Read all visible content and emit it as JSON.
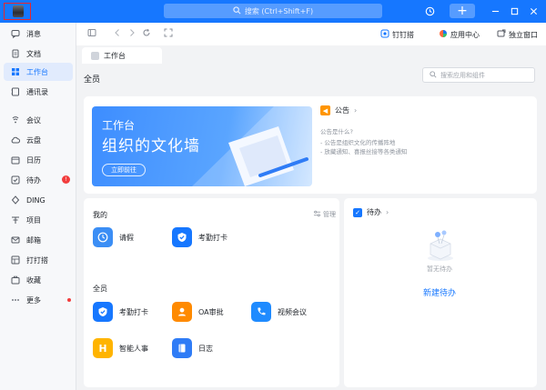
{
  "titlebar": {
    "search_placeholder": "搜索 (Ctrl+Shift+F)",
    "window_controls": [
      "history-icon",
      "plus-icon",
      "minimize-icon",
      "maximize-icon",
      "close-icon"
    ]
  },
  "sidebar": {
    "items": [
      {
        "label": "消息",
        "icon": "message-icon"
      },
      {
        "label": "文档",
        "icon": "doc-icon"
      },
      {
        "label": "工作台",
        "icon": "grid-icon",
        "active": true
      },
      {
        "label": "通讯录",
        "icon": "contacts-icon"
      },
      {
        "label": "会议",
        "icon": "meeting-icon"
      },
      {
        "label": "云盘",
        "icon": "cloud-icon"
      },
      {
        "label": "日历",
        "icon": "calendar-icon"
      },
      {
        "label": "待办",
        "icon": "todo-icon",
        "badge": "!"
      },
      {
        "label": "DING",
        "icon": "ding-icon"
      },
      {
        "label": "项目",
        "icon": "project-icon"
      },
      {
        "label": "邮箱",
        "icon": "mail-icon"
      },
      {
        "label": "打打搭",
        "icon": "build-icon"
      },
      {
        "label": "收藏",
        "icon": "favorite-icon"
      },
      {
        "label": "更多",
        "icon": "more-icon",
        "dot": true
      }
    ]
  },
  "toolbar": {
    "pin_label": "钉钉搭",
    "app_center_label": "应用中心",
    "standalone_label": "独立窗口"
  },
  "tab": {
    "label": "工作台"
  },
  "main": {
    "title": "全员",
    "search_placeholder": "搜索应用和组件",
    "banner": {
      "line1": "工作台",
      "line2": "组织的文化墙",
      "button": "立即前往"
    },
    "notice": {
      "label": "公告",
      "question": "公告是什么?",
      "bullet1": "- 公告是组织文化的传播阵地",
      "bullet2": "- 放藏通知、喜报丝接等各类通知"
    },
    "mine": {
      "title": "我的",
      "manage": "管理",
      "apps": [
        {
          "label": "请假",
          "color": "#3b8ef5"
        },
        {
          "label": "考勤打卡",
          "color": "#1677ff"
        }
      ]
    },
    "all": {
      "title": "全员",
      "apps": [
        {
          "label": "考勤打卡",
          "color": "#1677ff"
        },
        {
          "label": "OA审批",
          "color": "#ff8a00"
        },
        {
          "label": "视频会议",
          "color": "#1f8bff"
        },
        {
          "label": "智能人事",
          "color": "#ffb400"
        },
        {
          "label": "日志",
          "color": "#2f7cf6"
        }
      ]
    },
    "todo": {
      "title": "待办",
      "empty": "暂无待办",
      "new": "新建待办"
    }
  }
}
